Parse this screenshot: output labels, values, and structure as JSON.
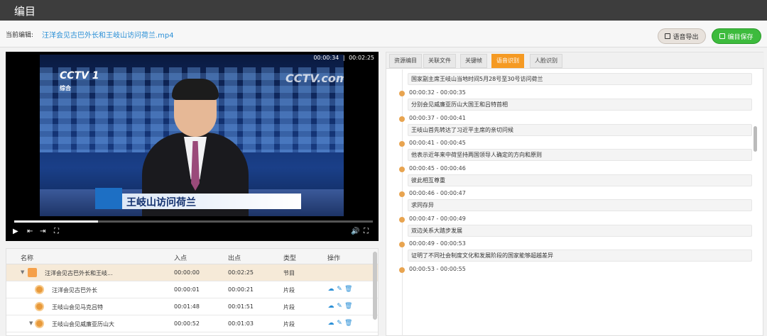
{
  "app": {
    "title": "编目"
  },
  "editbar": {
    "current_label": "当前编辑:",
    "current_file": "汪洋会见古巴外长和王岐山访问荷兰.mp4",
    "export_label": "语音导出",
    "save_label": "编目保存"
  },
  "player": {
    "current_time": "00:00:34",
    "separator": "|",
    "duration": "00:02:25",
    "progress": 0.234,
    "channel_logo": "CCTV 1",
    "channel_sub": "综合",
    "watermark": "CCTV.com",
    "caption": "王岐山访问荷兰"
  },
  "table": {
    "headers": {
      "name": "名称",
      "in": "入点",
      "out": "出点",
      "type": "类型",
      "ops": "操作"
    },
    "rows": [
      {
        "name": "汪洋会见古巴外长和王岐...",
        "in": "00:00:00",
        "out": "00:02:25",
        "type": "节目"
      },
      {
        "name": "汪洋会见古巴外长",
        "in": "00:00:01",
        "out": "00:00:21",
        "type": "片段"
      },
      {
        "name": "王岐山会见马克吕特",
        "in": "00:01:48",
        "out": "00:01:51",
        "type": "片段"
      },
      {
        "name": "王岐山会见威廉亚历山大",
        "in": "00:00:52",
        "out": "00:01:03",
        "type": "片段"
      }
    ]
  },
  "tabs": [
    {
      "label": "资源编目"
    },
    {
      "label": "关联文件"
    },
    {
      "label": "关键帧"
    },
    {
      "label": "语音识别"
    },
    {
      "label": "人脸识别"
    }
  ],
  "transcript": {
    "first_text": "国家副主席王岐山当地时间5月28号至30号访问荷兰",
    "items": [
      {
        "time": "00:00:32 - 00:00:35",
        "text": "分别会见威廉亚历山大国王和吕特首相"
      },
      {
        "time": "00:00:37 - 00:00:41",
        "text": "王岐山首先转达了习近平主席的亲切问候"
      },
      {
        "time": "00:00:41 - 00:00:45",
        "text": "他表示近年来中荷坚持两国领导人确定的方向和原则"
      },
      {
        "time": "00:00:45 - 00:00:46",
        "text": "彼此相互尊重"
      },
      {
        "time": "00:00:46 - 00:00:47",
        "text": "求同存异"
      },
      {
        "time": "00:00:47 - 00:00:49",
        "text": "双边关系大踏步发展"
      },
      {
        "time": "00:00:49 - 00:00:53",
        "text": "证明了不同社会制度文化和发展阶段的国家能够超越差异"
      },
      {
        "time": "00:00:53 - 00:00:55",
        "text": ""
      }
    ]
  },
  "colors": {
    "accent": "#f59a23",
    "link": "#2a8fd6",
    "save": "#3dbb3d"
  }
}
